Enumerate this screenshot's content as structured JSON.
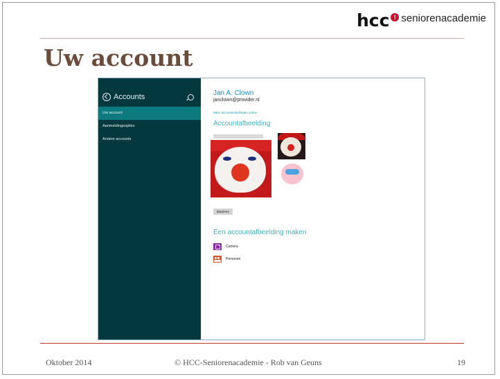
{
  "logo": {
    "brand": "hcc",
    "dot": "!",
    "sub": "seniorenacademie"
  },
  "slide": {
    "title": "Uw account"
  },
  "sidebar": {
    "title": "Accounts",
    "items": [
      {
        "label": "Uw account",
        "active": true
      },
      {
        "label": "Aanmeldingsopties",
        "active": false
      },
      {
        "label": "Andere accounts",
        "active": false
      }
    ]
  },
  "account": {
    "name": "Jan A. Clown",
    "email": "janclown@provider.nl",
    "more_link": "Meer accountinstellingen online",
    "picture_heading": "Accountafbeelding",
    "browse_label": "Bladeren",
    "make_heading": "Een accountafbeelding maken",
    "options": [
      {
        "label": "Camera",
        "icon": "camera-icon",
        "color": "#8b2a9e"
      },
      {
        "label": "Personen",
        "icon": "people-icon",
        "color": "#d9542a"
      }
    ]
  },
  "footer": {
    "date": "Oktober 2014",
    "credit": "© HCC-Seniorenacademie - Rob van Geuns",
    "page": "19"
  },
  "colors": {
    "sidebar_bg": "#04383f",
    "sidebar_active": "#0c7a7f",
    "title": "#6b4c3b",
    "accent": "#1c8bb8"
  }
}
